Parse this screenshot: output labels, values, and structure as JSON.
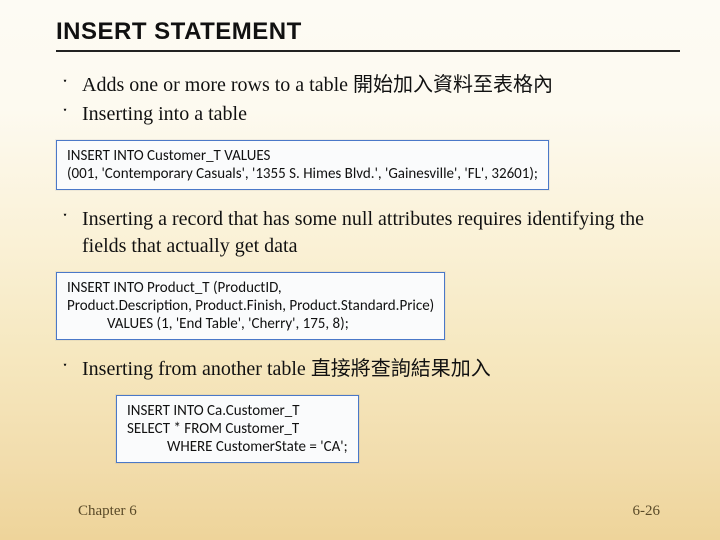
{
  "title": "INSERT STATEMENT",
  "bullets": {
    "b1_main": "Adds one or more rows to a table ",
    "b1_cjk": "開始加入資料至表格內",
    "b2": "Inserting into a table",
    "b3": "Inserting a record that has some null attributes requires identifying the fields that actually get data",
    "b4_main": "Inserting from another table ",
    "b4_cjk": "直接將查詢結果加入"
  },
  "snippets": {
    "s1": {
      "l1": "INSERT INTO Customer_T VALUES",
      "l2": "(001, 'Contemporary Casuals', '1355 S. Himes Blvd.', 'Gainesville', 'FL', 32601);"
    },
    "s2": {
      "l1": "INSERT INTO Product_T (ProductID,",
      "l2": "Product.Description, Product.Finish, Product.Standard.Price)",
      "l3": "VALUES (1, 'End Table', 'Cherry', 175, 8);"
    },
    "s3": {
      "l1": "INSERT INTO Ca.Customer_T",
      "l2": "SELECT * FROM Customer_T",
      "l3": "WHERE CustomerState = 'CA';"
    }
  },
  "footer": {
    "left": "Chapter 6",
    "right": "6-26"
  },
  "marker": "་"
}
